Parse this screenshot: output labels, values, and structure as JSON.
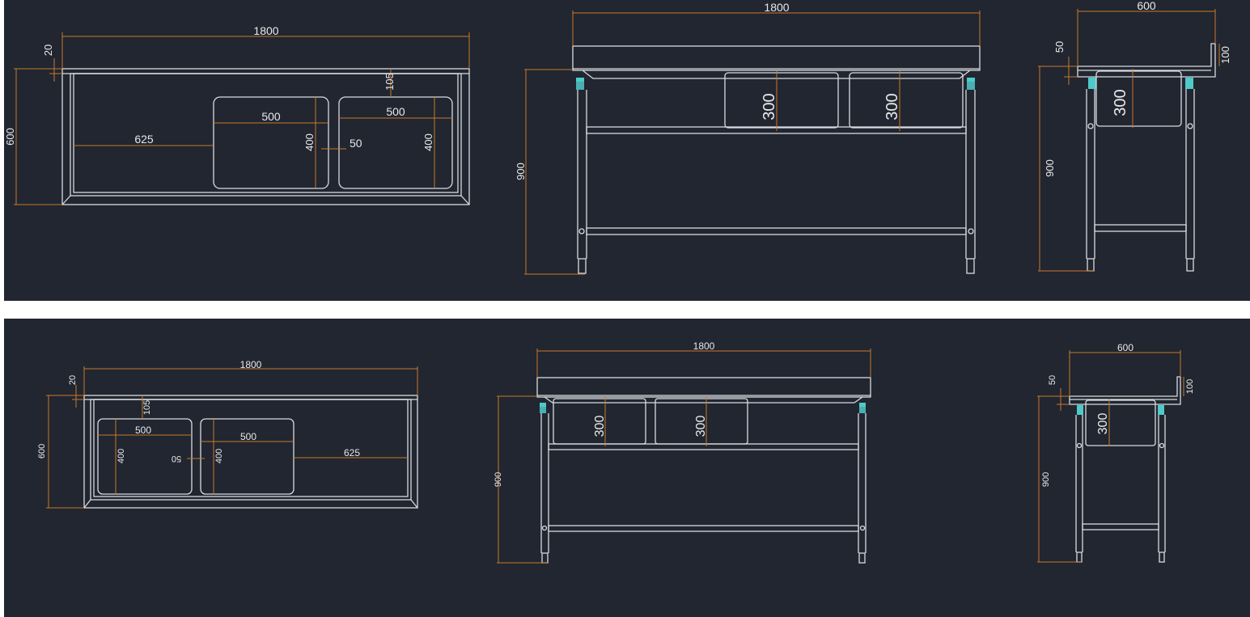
{
  "colors": {
    "background": "#212630",
    "linework": "#d9dbe0",
    "dimension": "#c9782a",
    "foot_cap": "#4fc9c9"
  },
  "top_drawing": {
    "plan": {
      "length": "1800",
      "thickness": "20",
      "depth": "600",
      "offset": "625",
      "bowl1_width": "500",
      "bowl1_depth": "400",
      "bowl2_width": "500",
      "bowl2_depth": "400",
      "gap": "50",
      "bowl_edge": "105"
    },
    "front": {
      "length": "1800",
      "height": "900",
      "bowl1_depth": "300",
      "bowl2_depth": "300"
    },
    "side": {
      "depth": "600",
      "top": "50",
      "upstand": "100",
      "height": "900",
      "bowl_depth": "300"
    }
  },
  "bottom_drawing": {
    "plan": {
      "length": "1800",
      "thickness": "20",
      "depth": "600",
      "offset": "625",
      "bowl1_width": "500",
      "bowl1_depth": "400",
      "bowl2_width": "500",
      "bowl2_depth": "400",
      "gap": "50",
      "bowl_edge": "105"
    },
    "front": {
      "length": "1800",
      "height": "900",
      "bowl1_depth": "300",
      "bowl2_depth": "300"
    },
    "side": {
      "depth": "600",
      "top": "50",
      "upstand": "100",
      "height": "900",
      "bowl_depth": "300"
    }
  }
}
